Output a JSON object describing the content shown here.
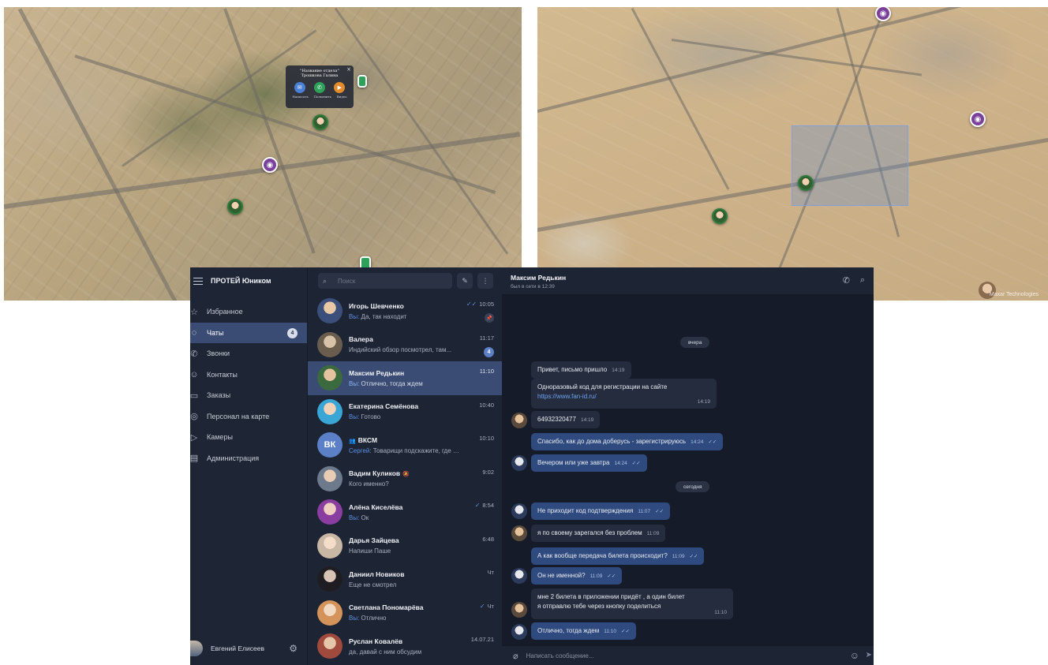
{
  "map_left": {
    "popup": {
      "title_line1": "\"Название отдела\"",
      "title_line2": "Трошкова Галина",
      "actions": [
        "Написать",
        "Позвонить",
        "Видео"
      ]
    }
  },
  "map_right": {
    "watermark": "Maxar Technologies"
  },
  "app": {
    "title": "ПРОТЕЙ Юником",
    "nav": [
      {
        "label": "Избранное",
        "icon": "star-icon",
        "glyph": "☆"
      },
      {
        "label": "Чаты",
        "icon": "chat-icon",
        "glyph": "◌",
        "badge": "4",
        "active": true
      },
      {
        "label": "Звонки",
        "icon": "phone-icon",
        "glyph": "✆"
      },
      {
        "label": "Контакты",
        "icon": "contacts-icon",
        "glyph": "☺"
      },
      {
        "label": "Заказы",
        "icon": "orders-icon",
        "glyph": "▭"
      },
      {
        "label": "Персонал на карте",
        "icon": "map-pin-icon",
        "glyph": "◎"
      },
      {
        "label": "Камеры",
        "icon": "camera-icon",
        "glyph": "▷"
      },
      {
        "label": "Администрация",
        "icon": "admin-icon",
        "glyph": "▤"
      }
    ],
    "user_name": "Евгений Елисеев"
  },
  "chatlist": {
    "search_placeholder": "Поиск",
    "you_prefix": "Вы:",
    "chats": [
      {
        "name": "Игорь Шевченко",
        "you": true,
        "preview": "Да, так находит",
        "time": "10:05",
        "tick": "✓✓",
        "pinned": true
      },
      {
        "name": "Валера",
        "you": false,
        "preview": "Индийский обзор посмотрел, там...",
        "time": "11:17",
        "unread": "4"
      },
      {
        "name": "Максим Редькин",
        "you": true,
        "preview": "Отлично, тогда ждем",
        "time": "11:10",
        "active": true
      },
      {
        "name": "Екатерина Семёнова",
        "you": true,
        "preview": "Готово",
        "time": "10:40"
      },
      {
        "name": "ВКСМ",
        "group": true,
        "initials": "ВК",
        "sender": "Сергей:",
        "preview": "Товарищи подскажите, где вз...",
        "time": "10:10"
      },
      {
        "name": "Вадим Куликов",
        "muted": true,
        "you": false,
        "preview": "Кого именно?",
        "time": "9:02"
      },
      {
        "name": "Алёна Киселёва",
        "you": true,
        "preview": "Ок",
        "time": "8:54",
        "tick": "✓"
      },
      {
        "name": "Дарья Зайцева",
        "you": false,
        "preview": "Напиши Паше",
        "time": "6:48"
      },
      {
        "name": "Даниил Новиков",
        "you": false,
        "preview": "Еще не смотрел",
        "time": "Чт"
      },
      {
        "name": "Светлана Пономарёва",
        "you": true,
        "preview": "Отлично",
        "time": "Чт",
        "tick": "✓"
      },
      {
        "name": "Руслан Ковалёв",
        "you": false,
        "preview": "да, давай с ним обсудим",
        "time": "14.07.21"
      }
    ]
  },
  "conversation": {
    "contact_name": "Максим Редькин",
    "status": "был в сети в 12:39",
    "day_yesterday": "вчера",
    "day_today": "сегодня",
    "messages": [
      {
        "text": "Привет, письмо пришло",
        "time": "14:19"
      },
      {
        "text": "Одноразовый код для регистрации на сайте",
        "link": "https://www.fan-id.ru/",
        "time": "14:19"
      },
      {
        "text": "64932320477",
        "time": "14:19"
      },
      {
        "text": "Спасибо, как до дома доберусь - зарегистрируюсь",
        "time": "14:24"
      },
      {
        "text": "Вечером или уже завтра",
        "time": "14:24"
      },
      {
        "text": "Не приходит код подтверждения",
        "time": "11:07"
      },
      {
        "text": "я по своему зарегался без проблем",
        "time": "11:09"
      },
      {
        "text": "А как вообще передача билета происходит?",
        "time": "11:09"
      },
      {
        "text": "Он не именной?",
        "time": "11:09"
      },
      {
        "line1": "мне 2 билета в приложении придёт , а один билет",
        "line2": "я отправлю тебе через кнопку поделиться",
        "time": "11:10"
      },
      {
        "text": "Отлично, тогда ждем",
        "time": "11:10"
      }
    ],
    "composer_placeholder": "Написать сообщение..."
  },
  "colors": {
    "app_bg": "#1b2231",
    "active_item": "#3a4c74",
    "accent": "#5d8fe0",
    "outgoing_bubble": "#2f4a7e",
    "incoming_bubble": "#242c3d"
  }
}
